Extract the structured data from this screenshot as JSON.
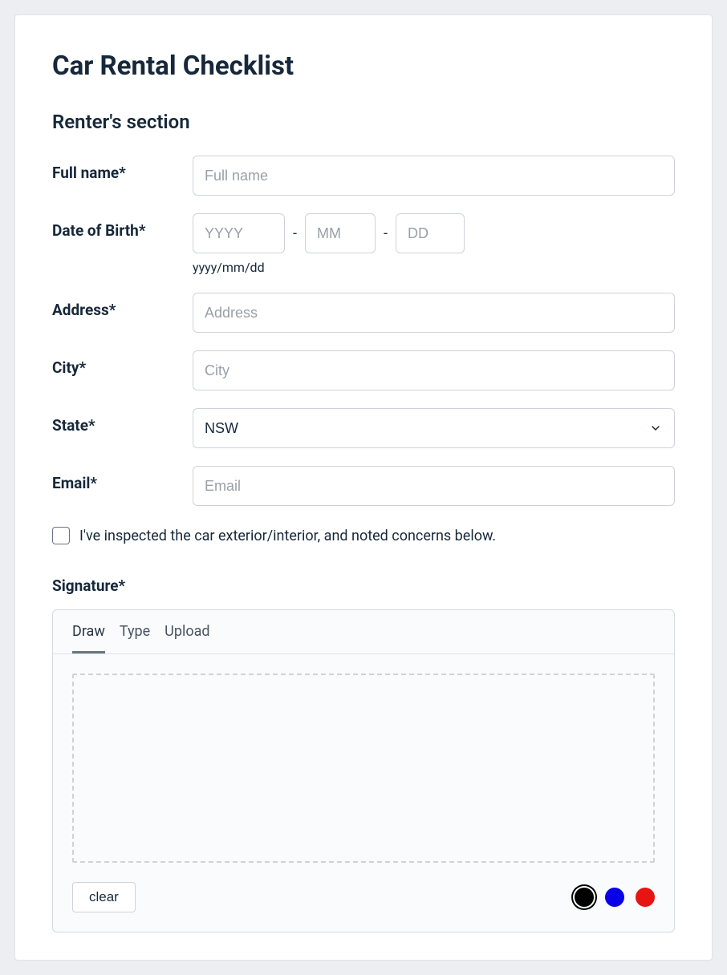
{
  "title": "Car Rental Checklist",
  "section_title": "Renter's section",
  "fields": {
    "full_name": {
      "label": "Full name*",
      "placeholder": "Full name",
      "value": ""
    },
    "dob": {
      "label": "Date of Birth*",
      "year_placeholder": "YYYY",
      "month_placeholder": "MM",
      "day_placeholder": "DD",
      "year_value": "",
      "month_value": "",
      "day_value": "",
      "separator": "-",
      "hint": "yyyy/mm/dd"
    },
    "address": {
      "label": "Address*",
      "placeholder": "Address",
      "value": ""
    },
    "city": {
      "label": "City*",
      "placeholder": "City",
      "value": ""
    },
    "state": {
      "label": "State*",
      "value": "NSW"
    },
    "email": {
      "label": "Email*",
      "placeholder": "Email",
      "value": ""
    }
  },
  "inspected": {
    "checked": false,
    "label": "I've inspected the car exterior/interior, and noted concerns below."
  },
  "signature": {
    "label": "Signature*",
    "tabs": {
      "draw": "Draw",
      "type": "Type",
      "upload": "Upload"
    },
    "active_tab": "draw",
    "clear_label": "clear",
    "colors": {
      "black": "#000000",
      "blue": "#0900e8",
      "red": "#e81313"
    },
    "selected_color": "black"
  }
}
